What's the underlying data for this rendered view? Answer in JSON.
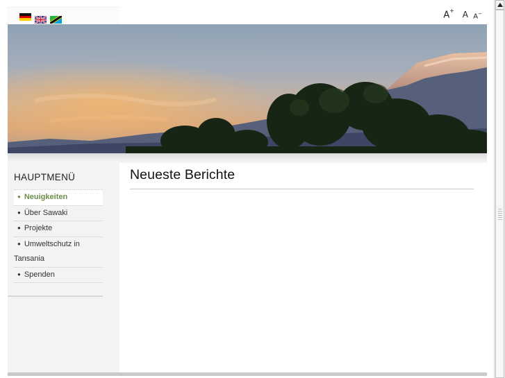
{
  "languages": [
    {
      "name": "Deutsch",
      "icon": "german-flag-icon"
    },
    {
      "name": "English",
      "icon": "uk-flag-icon"
    },
    {
      "name": "Swahili",
      "icon": "tanzania-flag-icon"
    }
  ],
  "font_size_controls": {
    "increase": "A",
    "increase_mark": "+",
    "reset": "A",
    "decrease": "A",
    "decrease_mark": "−"
  },
  "sidebar": {
    "title": "HAUPTMENÜ",
    "items": [
      {
        "label": "Neuigkeiten",
        "active": true
      },
      {
        "label": "Über Sawaki",
        "active": false
      },
      {
        "label": "Projekte",
        "active": false
      },
      {
        "label": "Umweltschutz in Tansania",
        "active": false
      },
      {
        "label": "Spenden",
        "active": false
      }
    ]
  },
  "main": {
    "title": "Neueste Berichte"
  },
  "colors": {
    "active_menu": "#6c8f49",
    "sidebar_bg": "#f3f3f3",
    "footer_bar": "#c9c9c9"
  }
}
